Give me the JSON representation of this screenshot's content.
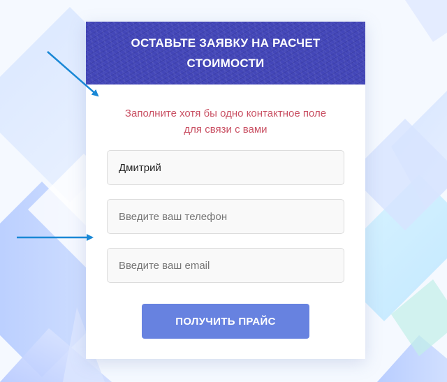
{
  "form": {
    "title": "ОСТАВЬТЕ ЗАЯВКУ НА РАСЧЕТ СТОИМОСТИ",
    "notice": "Заполните хотя бы одно контактное поле для связи с вами",
    "name_field": {
      "value": "Дмитрий",
      "placeholder": ""
    },
    "phone_field": {
      "value": "",
      "placeholder": "Введите ваш телефон"
    },
    "email_field": {
      "value": "",
      "placeholder": "Введите ваш email"
    },
    "submit_label": "ПОЛУЧИТЬ ПРАЙС"
  },
  "colors": {
    "header_bg": "#4346b8",
    "notice_text": "#c95063",
    "button_bg": "#6782e0",
    "arrow": "#1a88d6"
  }
}
